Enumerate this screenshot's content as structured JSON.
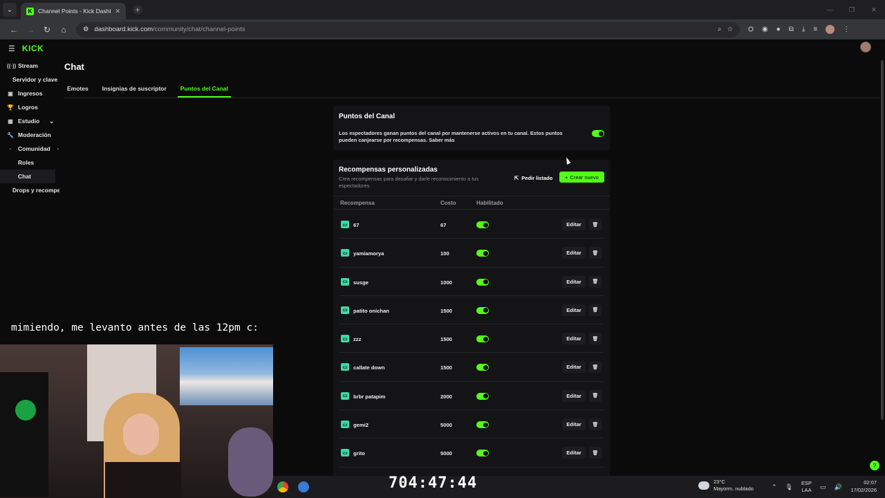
{
  "browser": {
    "tab_title": "Channel Points - Kick Dashboar",
    "url_domain": "dashboard.kick.com",
    "url_path": "/community/chat/channel-points"
  },
  "brand": {
    "logo": "KICK",
    "accent": "#53fc18"
  },
  "sidebar": {
    "items": [
      {
        "label": "Stream",
        "icon": "radio-icon"
      },
      {
        "label": "Servidor y clave de"
      },
      {
        "label": "Ingresos",
        "icon": "wallet-icon"
      },
      {
        "label": "Logros",
        "icon": "trophy-icon"
      },
      {
        "label": "Estudio",
        "icon": "studio-icon"
      },
      {
        "label": "Moderación",
        "icon": "wrench-icon"
      },
      {
        "label": "Comunidad"
      },
      {
        "label": "Roles"
      },
      {
        "label": "Chat"
      },
      {
        "label": "Drops y recompensas"
      }
    ]
  },
  "page": {
    "title": "Chat",
    "tabs": [
      "Emotes",
      "Insignias de suscriptor",
      "Puntos del Canal"
    ]
  },
  "points_card": {
    "title": "Puntos del Canal",
    "description": "Los espectadores ganan puntos del canal por mantenerse activos en tu canal. Estos puntos pueden canjearse por recompensas. Saber más"
  },
  "rewards_card": {
    "title": "Recompensas personalizadas",
    "description": "Crea recompensas para desafiar y darle reconocimiento a tus espectadores",
    "pedir_label": "Pedir listado",
    "crear_label": "Crear nuevo",
    "columns": [
      "Recompensa",
      "Costo",
      "Habilitado"
    ],
    "edit_label": "Editar",
    "rows": [
      {
        "name": "67",
        "cost": "67"
      },
      {
        "name": "yamiamorya",
        "cost": "100"
      },
      {
        "name": "susge",
        "cost": "1000"
      },
      {
        "name": "patito onichan",
        "cost": "1500"
      },
      {
        "name": "zzz",
        "cost": "1500"
      },
      {
        "name": "callate down",
        "cost": "1500"
      },
      {
        "name": "brbr patapim",
        "cost": "2000"
      },
      {
        "name": "gemi2",
        "cost": "5000"
      },
      {
        "name": "grito",
        "cost": "5000"
      }
    ]
  },
  "overlay": {
    "caption": "mimiendo, me levanto antes de las 12pm c:",
    "timer": "704:47:44"
  },
  "taskbar": {
    "temp": "23°C",
    "weather": "Mayorm. nublado",
    "lang1": "ESP",
    "lang2": "LAA",
    "time": "02:07",
    "date": "17/02/2026"
  }
}
